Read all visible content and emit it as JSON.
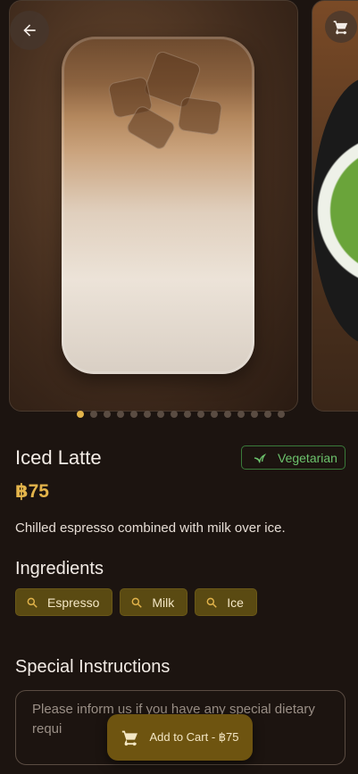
{
  "product": {
    "name": "Iced Latte",
    "price": "฿75",
    "description": "Chilled espresso combined with milk over ice.",
    "badge": "Vegetarian"
  },
  "carousel": {
    "page_count": 16,
    "active_index": 0
  },
  "ingredients": {
    "title": "Ingredients",
    "items": [
      "Espresso",
      "Milk",
      "Ice"
    ]
  },
  "special_instructions": {
    "title": "Special Instructions",
    "placeholder": "Please inform us if you have any special dietary requi"
  },
  "cta": {
    "label": "Add to Cart - ฿75"
  },
  "icons": {
    "back": "back-arrow-icon",
    "cart": "cart-icon",
    "vegetarian": "leaf-icon",
    "ingredient": "search-icon"
  },
  "colors": {
    "background": "#1c1410",
    "accent": "#e3b44b",
    "chip": "#5a4a12",
    "vegetarian": "#6cc26c",
    "cta": "#6e5410"
  }
}
